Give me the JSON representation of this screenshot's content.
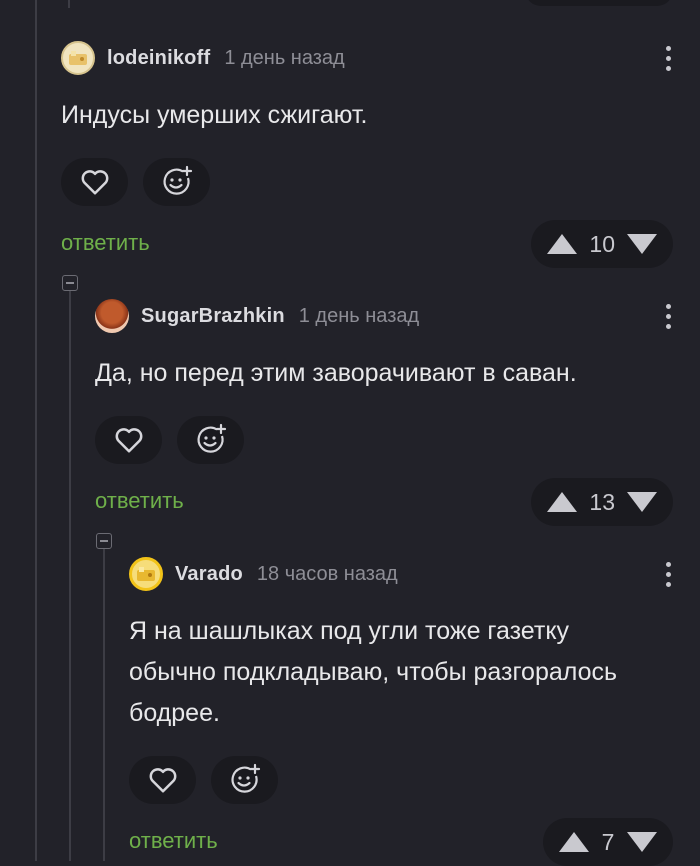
{
  "comments": [
    {
      "author": "lodeinikoff",
      "time": "1 день назад",
      "text": "Индусы умерших сжигают.",
      "reply_label": "ответить",
      "score": "10"
    },
    {
      "author": "SugarBrazhkin",
      "time": "1 день назад",
      "text": "Да, но перед этим заворачивают в саван.",
      "reply_label": "ответить",
      "score": "13"
    },
    {
      "author": "Varado",
      "time": "18 часов назад",
      "text": "Я на шашлыках под угли тоже газетку обычно подкладываю, чтобы разгоралось бодрее.",
      "reply_label": "ответить",
      "score": "7"
    }
  ],
  "icons": {
    "like": "heart-icon",
    "react": "smile-add-icon",
    "more": "more-vertical-icon",
    "upvote": "upvote-icon",
    "downvote": "downvote-icon",
    "collapse": "collapse-icon"
  },
  "colors": {
    "background": "#222229",
    "reply": "#6fb04a",
    "pill": "#1a1a1f"
  }
}
